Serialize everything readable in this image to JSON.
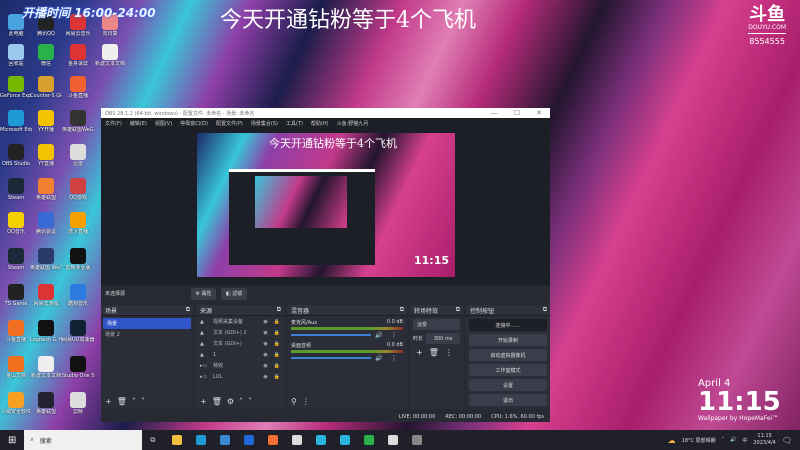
{
  "overlay": {
    "time": "开播时间 16:00-24:00",
    "title": "今天开通钻粉等于4个飞机",
    "douyu_logo": "斗鱼",
    "douyu_domain": "DOUYU.COM",
    "room_id": "8554555"
  },
  "desktop_icons": [
    {
      "label": "此电脑",
      "color": "#4aa3df"
    },
    {
      "label": "腾讯QQ",
      "color": "#222"
    },
    {
      "label": "网易云音乐",
      "color": "#d33"
    },
    {
      "label": "向日葵",
      "color": "#e88"
    },
    {
      "label": "回收站",
      "color": "#9cc8ee"
    },
    {
      "label": "微信",
      "color": "#2ab24a"
    },
    {
      "label": "金舟录屏",
      "color": "#d33"
    },
    {
      "label": "新建文本文档",
      "color": "#eee"
    },
    {
      "label": "GeForce Experience",
      "color": "#76b900"
    },
    {
      "label": "Counter-S Global Off...",
      "color": "#d8a030"
    },
    {
      "label": "斗鱼直播",
      "color": "#f06030"
    },
    {
      "label": "Microsoft Edge",
      "color": "#1e9ad6"
    },
    {
      "label": "YY开播",
      "color": "#f5c400"
    },
    {
      "label": "英雄联盟WeGame版",
      "color": "#333"
    },
    {
      "label": "OBS Studio",
      "color": "#222"
    },
    {
      "label": "YY直播",
      "color": "#f5c400"
    },
    {
      "label": "迅雷",
      "color": "#ddd"
    },
    {
      "label": "Steam",
      "color": "#1b2838"
    },
    {
      "label": "英雄联盟",
      "color": "#f08030"
    },
    {
      "label": "QQ游戏",
      "color": "#d04040"
    },
    {
      "label": "QQ音乐",
      "color": "#f5d000"
    },
    {
      "label": "腾讯会议",
      "color": "#3a6ad6"
    },
    {
      "label": "虎牙直播",
      "color": "#f5a000"
    },
    {
      "label": "Steam",
      "color": "#1b2838"
    },
    {
      "label": "英雄联盟 WeGame版",
      "color": "#2a3a6a"
    },
    {
      "label": "剪映专业版",
      "color": "#111"
    },
    {
      "label": "TS Game",
      "color": "#222"
    },
    {
      "label": "网易云游戏",
      "color": "#d33"
    },
    {
      "label": "酷狗音乐",
      "color": "#2a7ae0"
    },
    {
      "label": "斗鱼直播",
      "color": "#f07020"
    },
    {
      "label": "Logitech G HUB",
      "color": "#111"
    },
    {
      "label": "网易UU加速器",
      "color": "#123"
    },
    {
      "label": "金山文档",
      "color": "#f07020"
    },
    {
      "label": "新建文本文档",
      "color": "#eee"
    },
    {
      "label": "Studio One 5",
      "color": "#111"
    },
    {
      "label": "火绒安全软件",
      "color": "#f5a020"
    },
    {
      "label": "英雄联盟",
      "color": "#223"
    },
    {
      "label": "剪映",
      "color": "#ddd"
    }
  ],
  "obs": {
    "title": "OBS 28.1.2 (64-bit, windows) - 配置文件: 未命名 - 场景: 未命名",
    "menu": [
      "文件(F)",
      "编辑(E)",
      "视图(V)",
      "停靠窗口(D)",
      "配置文件(P)",
      "场景集合(S)",
      "工具(T)",
      "帮助(H)",
      "斗鱼:野猫九月"
    ],
    "no_source": "未选择源",
    "properties": "⚙ 属性",
    "filters": "◧ 滤镜",
    "scenes": {
      "title": "场景",
      "items": [
        "场景",
        "场景 2"
      ]
    },
    "sources": {
      "title": "来源",
      "items": [
        "视频采集设备",
        "文本 (GDI+) 2",
        "文本 (GDI+)",
        "1",
        "特效",
        "LOL"
      ]
    },
    "mixer": {
      "title": "混音器",
      "channels": [
        {
          "name": "麦克风/Aux",
          "db": "0.0 dB",
          "level": 0.8
        },
        {
          "name": "桌面音频",
          "db": "0.0 dB",
          "level": 0.8
        }
      ]
    },
    "transitions": {
      "title": "转场特效",
      "type": "淡变",
      "duration_label": "时长",
      "duration": "300 ms"
    },
    "controls": {
      "title": "控制按钮",
      "buttons": [
        "连接中……",
        "开始录制",
        "启动虚拟摄像机",
        "工作室模式",
        "设置",
        "退出"
      ]
    },
    "status": {
      "live": "LIVE: 00:00:00",
      "rec": "REC: 00:00:00",
      "cpu": "CPU: 1.6%, 60.00 fps"
    }
  },
  "clock_widget": {
    "date": "April 4",
    "time": "11:15",
    "credit": "Wallpaper by HopeMaFei™"
  },
  "taskbar": {
    "search": "搜索",
    "weather": "18°C 局部晴朗",
    "time": "11:15",
    "date": "2023/4/4",
    "ime": "中",
    "apps": [
      "#f0c040",
      "#1e9ad6",
      "#3a8ad6",
      "#1e6ad6",
      "#f07030",
      "#ddd",
      "#2ab4e0",
      "#2ab4e0",
      "#2ab24a",
      "#ddd",
      "#888"
    ]
  }
}
